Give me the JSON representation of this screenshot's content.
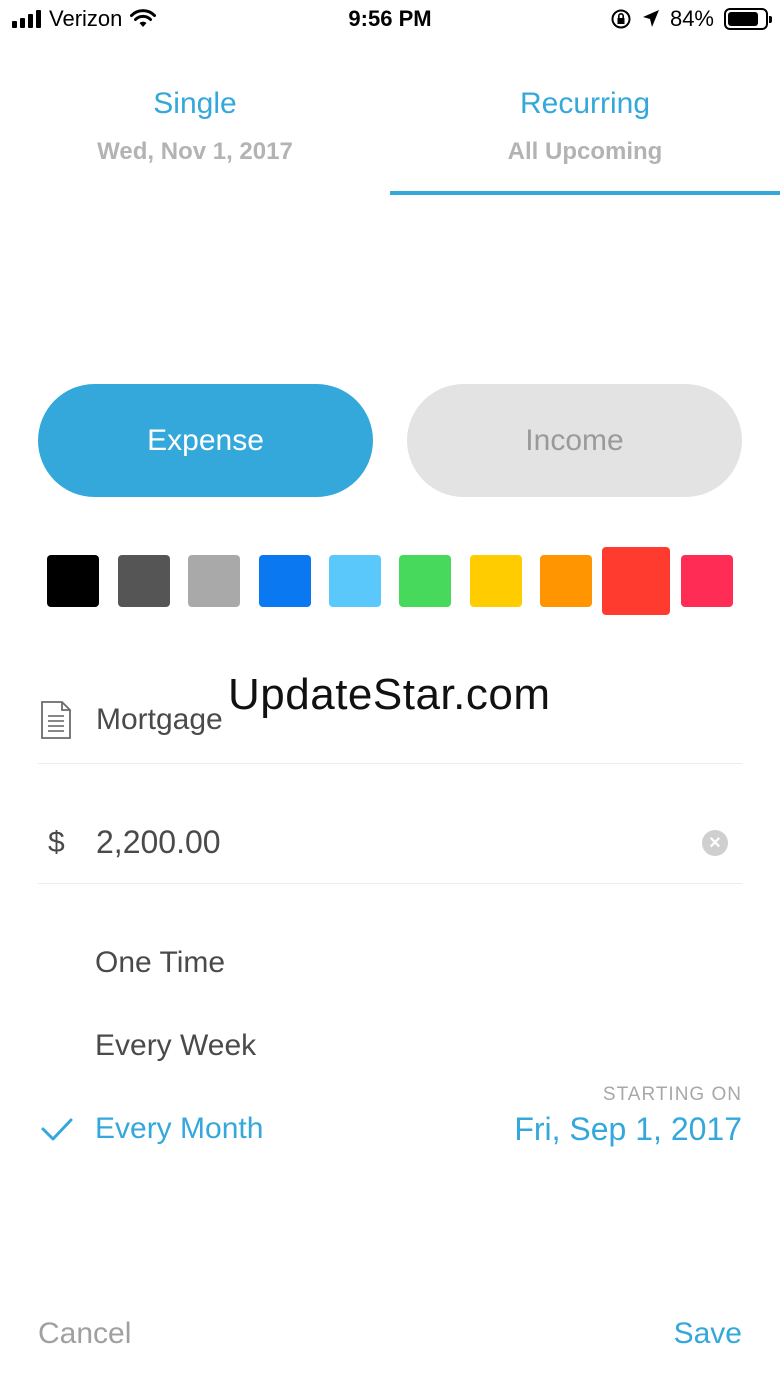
{
  "status_bar": {
    "carrier": "Verizon",
    "time": "9:56 PM",
    "battery": "84%",
    "battery_level": 0.84,
    "icons": [
      "signal-icon",
      "wifi-icon",
      "rotation-lock-icon",
      "location-icon",
      "battery-icon"
    ]
  },
  "tabs": {
    "single": {
      "title": "Single",
      "subtitle": "Wed, Nov 1, 2017"
    },
    "recurring": {
      "title": "Recurring",
      "subtitle": "All Upcoming"
    },
    "active": "recurring"
  },
  "type_toggle": {
    "expense_label": "Expense",
    "income_label": "Income",
    "active": "expense"
  },
  "colors": {
    "accent": "#34a8db",
    "swatches": [
      "#000000",
      "#555555",
      "#a9a9a9",
      "#0a78f0",
      "#5ac8fa",
      "#46d95b",
      "#ffcc00",
      "#ff9500",
      "#ff3b30",
      "#ff2d55"
    ],
    "selected_index": 8
  },
  "watermark": "UpdateStar.com",
  "form": {
    "name": "Mortgage",
    "currency_symbol": "$",
    "amount": "2,200.00"
  },
  "frequency": {
    "options": [
      "One Time",
      "Every Week",
      "Every Month"
    ],
    "selected": "Every Month",
    "starting_label": "STARTING ON",
    "starting_date": "Fri, Sep 1, 2017"
  },
  "footer": {
    "cancel_label": "Cancel",
    "save_label": "Save"
  }
}
